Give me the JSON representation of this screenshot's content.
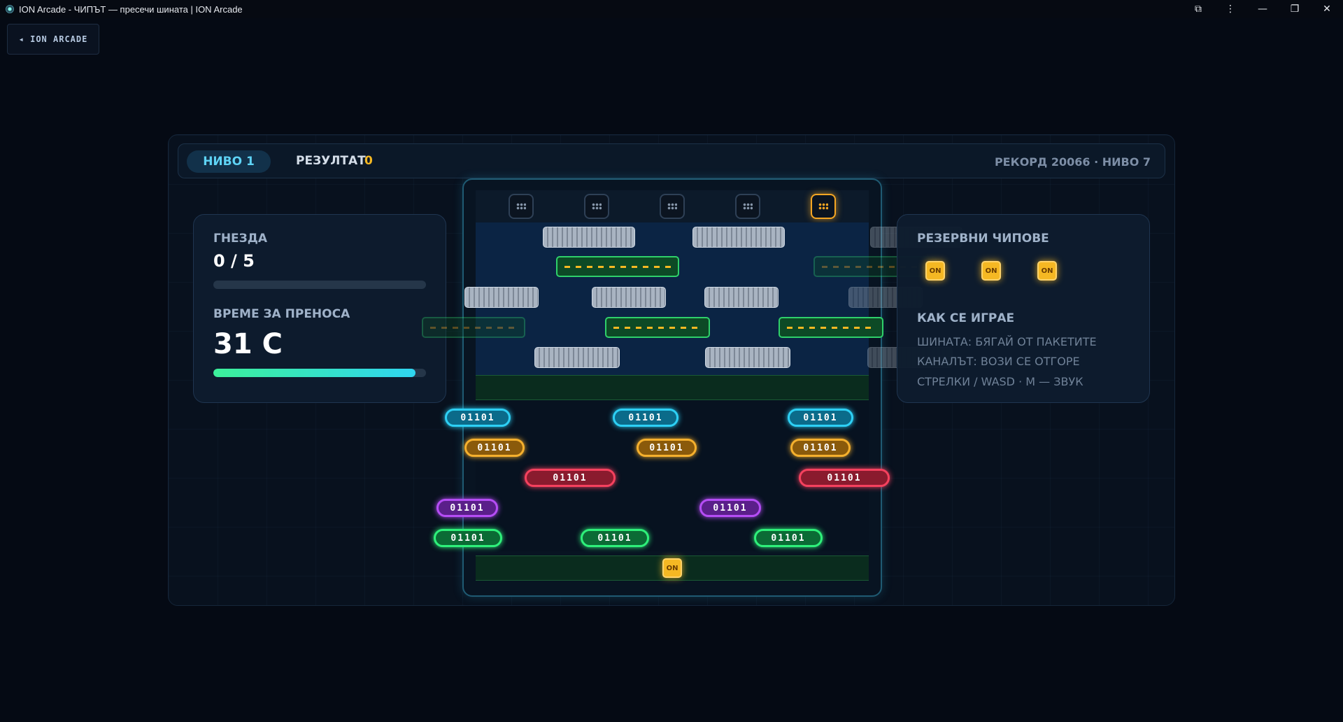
{
  "window": {
    "title": "ION Arcade - ЧИПЪТ — пресечи шината | ION Arcade",
    "controls": [
      "⧉",
      "⋮",
      "—",
      "❐",
      "✕"
    ]
  },
  "back_button": {
    "label": "◂ ION ARCADE"
  },
  "hud": {
    "level_label": "НИВО 1",
    "score_label": "РЕЗУЛТАТ",
    "score_value": "0",
    "record_text": "РЕКОРД 20066 · НИВО 7"
  },
  "left_panel": {
    "sockets_label": "ГНЕЗДА",
    "sockets_value": "0 / 5",
    "sockets_progress": 0,
    "time_label": "ВРЕМЕ ЗА ПРЕНОСА",
    "time_value": "31 С",
    "time_progress": 0.95
  },
  "board": {
    "sockets": [
      {
        "active": false
      },
      {
        "active": false
      },
      {
        "active": false
      },
      {
        "active": false
      },
      {
        "active": true
      }
    ],
    "packet_text": "01101",
    "player_chip_label": "ON"
  },
  "right_panel": {
    "spare_chips_label": "РЕЗЕРВНИ ЧИПОВЕ",
    "spare_chip_label": "ON",
    "spare_chips_count": 3,
    "howto_label": "КАК СЕ ИГРАЕ",
    "howto_lines": [
      "ШИНАТА: БЯГАЙ ОТ ПАКЕТИТЕ",
      "КАНАЛЪТ: ВОЗИ СЕ ОТГОРЕ",
      "СТРЕЛКИ / WASD · M — ЗВУК"
    ]
  },
  "colors": {
    "accent_cyan": "#2dd0f5",
    "accent_amber": "#f5b823",
    "accent_green": "#2ef07a",
    "accent_red": "#f5415e",
    "accent_purple": "#b54df5"
  }
}
